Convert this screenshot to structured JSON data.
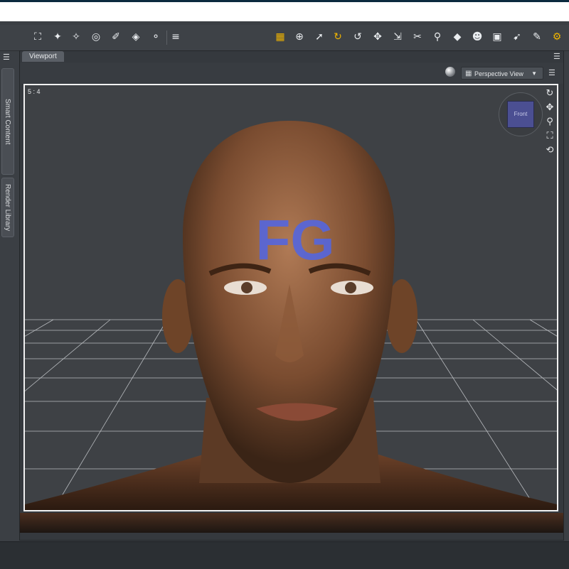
{
  "window": {
    "bar_color": "#0b2a3e"
  },
  "toolbar": {
    "left_icons": [
      "node-camera-icon",
      "joint-editor-icon",
      "surface-selection-icon",
      "region-navigator-icon",
      "transform-icon",
      "geometry-editor-icon",
      "tool-settings-icon",
      "align-icon"
    ],
    "right_icons": [
      "active-pose-icon",
      "universal-tool-icon",
      "node-selection-icon",
      "rotate-icon",
      "translate-icon",
      "scale-icon",
      "surface-selection-icon",
      "node-weight-icon",
      "geometry-sculpt-icon",
      "figure-icon",
      "camera-icon",
      "spot-render-icon",
      "edit-icon",
      "render-settings-icon"
    ],
    "accent_color": "#f0b400"
  },
  "sidebar": {
    "tabs": [
      "Smart Content",
      "Render Library"
    ]
  },
  "viewport": {
    "tab_label": "Viewport",
    "aspect_label": "5 : 4",
    "view_label": "Perspective View",
    "view_cube_label": "Front",
    "camera_icons": [
      "orbit-icon",
      "pan-icon",
      "zoom-icon",
      "frame-icon",
      "reset-icon"
    ]
  },
  "scene": {
    "forehead_text": "FG",
    "forehead_text_color": "#5566dd",
    "grid_color": "#cfd2d6",
    "skin_color": "#8a5a3a"
  }
}
